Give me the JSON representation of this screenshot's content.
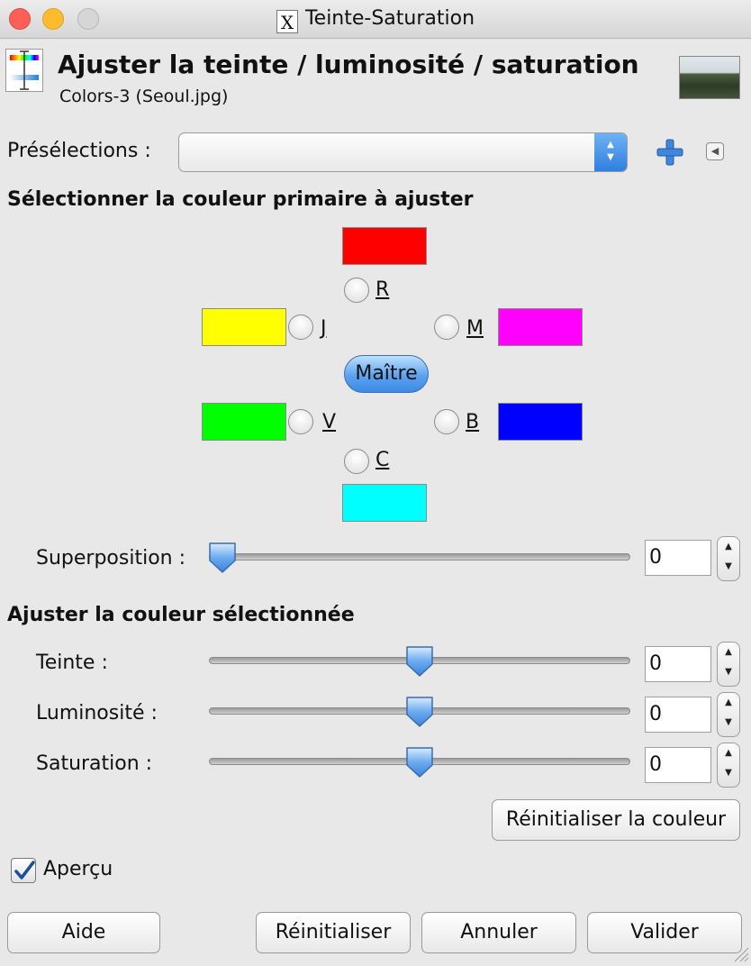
{
  "window": {
    "title": "Teinte-Saturation",
    "title_icon": "x11-icon"
  },
  "header": {
    "title": "Ajuster la teinte / luminosité / saturation",
    "subtitle": "Colors-3 (Seoul.jpg)",
    "icon": "hue-saturation-icon"
  },
  "presets": {
    "label": "Présélections :",
    "value": ""
  },
  "primary": {
    "heading": "Sélectionner la couleur primaire à ajuster",
    "channels": [
      {
        "label": "R",
        "color": "#ff0000"
      },
      {
        "label": "J",
        "color": "#ffff00"
      },
      {
        "label": "M",
        "color": "#ff00ff"
      },
      {
        "label": "V",
        "color": "#00ff00"
      },
      {
        "label": "B",
        "color": "#0000ff"
      },
      {
        "label": "C",
        "color": "#00ffff"
      }
    ],
    "master_label": "Maître",
    "overlap": {
      "label": "Superposition :",
      "value": "0",
      "fraction": 0.0
    }
  },
  "adjust": {
    "heading": "Ajuster la couleur sélectionnée",
    "hue": {
      "label": "Teinte :",
      "value": "0",
      "fraction": 0.5
    },
    "lightness": {
      "label": "Luminosité :",
      "value": "0",
      "fraction": 0.5
    },
    "saturation": {
      "label": "Saturation :",
      "value": "0",
      "fraction": 0.5
    },
    "reset_color_label": "Réinitialiser la couleur"
  },
  "preview": {
    "label": "Aperçu",
    "checked": true
  },
  "buttons": {
    "help": "Aide",
    "reset": "Réinitialiser",
    "cancel": "Annuler",
    "ok": "Valider"
  }
}
